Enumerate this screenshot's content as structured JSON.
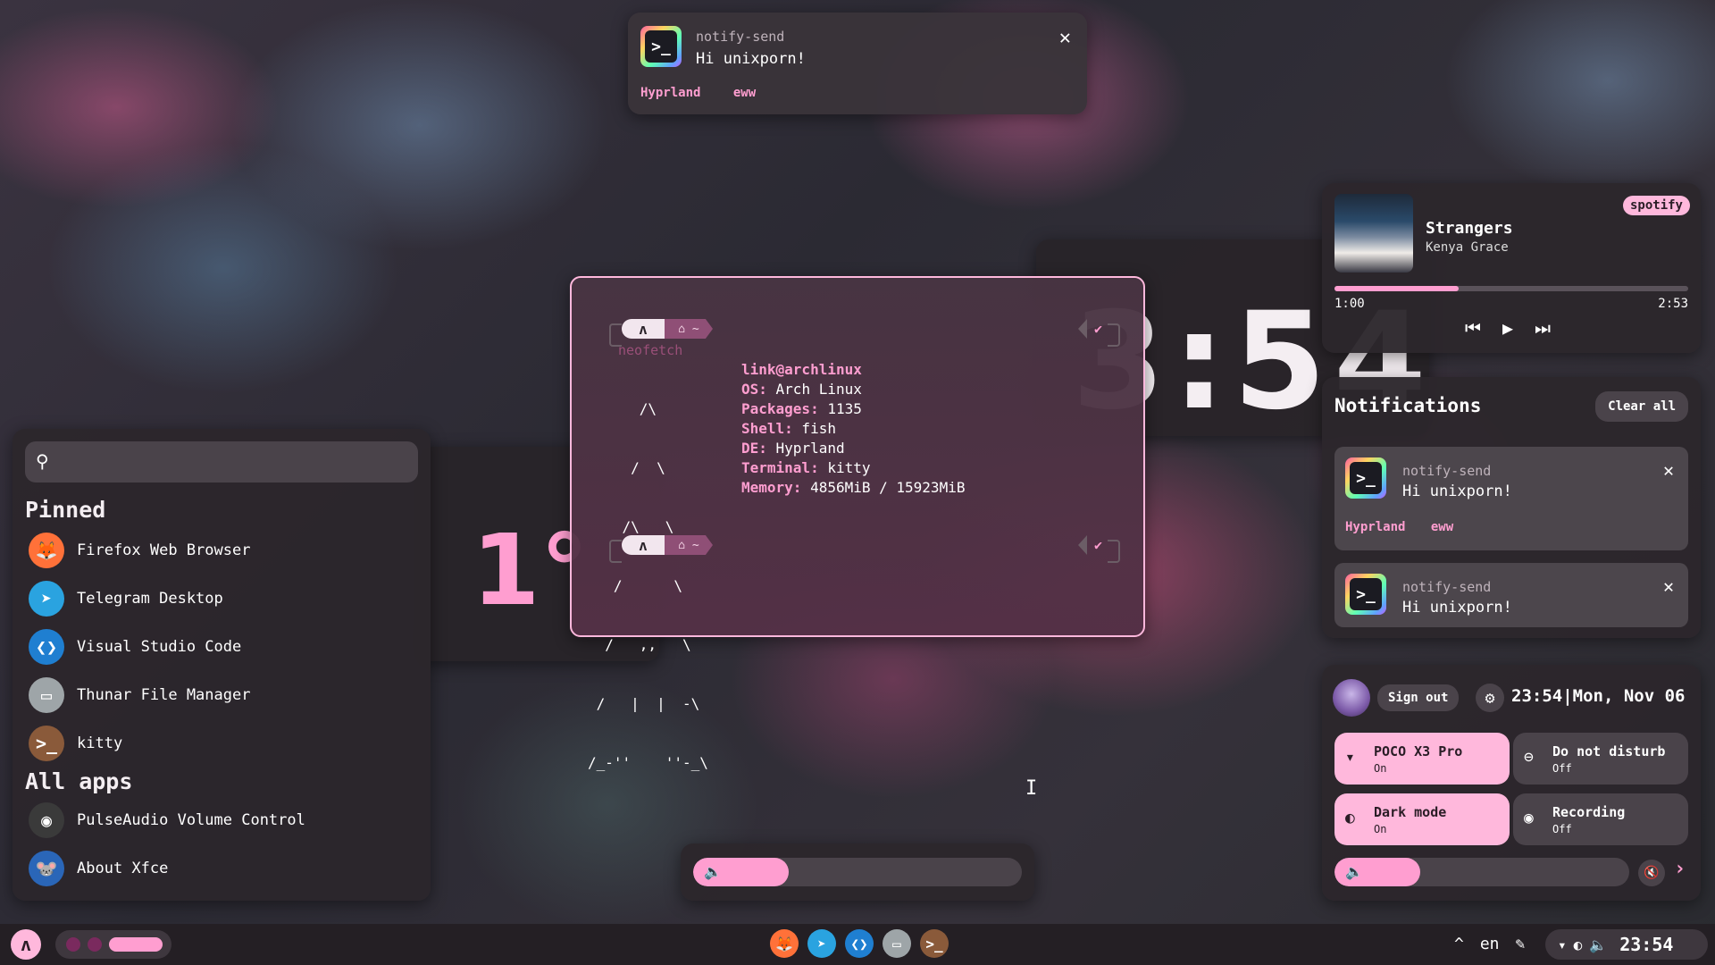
{
  "popup": {
    "app": "notify-send",
    "body": "Hi unixporn!",
    "close": "✕",
    "tags": [
      "Hyprland",
      "eww"
    ]
  },
  "clock": {
    "text": "3:54"
  },
  "weather": {
    "temp": "1°"
  },
  "terminal": {
    "prompt_home": "⌂ ~",
    "prompt_arch": "ʌ",
    "check": "✔",
    "command": "neofetch",
    "ascii": [
      "      /\\",
      "     /  \\",
      "    /\\   \\",
      "   /      \\",
      "  /   ,,   \\",
      " /   |  |  -\\",
      "/_-''    ''-_\\"
    ],
    "info": [
      {
        "key": "link@archlinux",
        "val": ""
      },
      {
        "key": "OS:",
        "val": " Arch Linux"
      },
      {
        "key": "Packages:",
        "val": " 1135"
      },
      {
        "key": "Shell:",
        "val": " fish"
      },
      {
        "key": "DE:",
        "val": " Hyprland"
      },
      {
        "key": "Terminal:",
        "val": " kitty"
      },
      {
        "key": "Memory:",
        "val": " 4856MiB / 15923MiB"
      }
    ]
  },
  "launcher": {
    "search_placeholder": "",
    "pinned_title": "Pinned",
    "all_title": "All apps",
    "pinned": [
      {
        "label": "Firefox Web Browser",
        "icon": "firefox-icon",
        "color": "#ff7139",
        "glyph": "🦊"
      },
      {
        "label": "Telegram Desktop",
        "icon": "telegram-icon",
        "color": "#2aa3e0",
        "glyph": "➤"
      },
      {
        "label": "Visual Studio Code",
        "icon": "vscode-icon",
        "color": "#1f7fd1",
        "glyph": "❮❯"
      },
      {
        "label": "Thunar File Manager",
        "icon": "thunar-icon",
        "color": "#9ea5a8",
        "glyph": "▭"
      },
      {
        "label": "kitty",
        "icon": "kitty-icon",
        "color": "#8a5a3a",
        "glyph": ">_"
      }
    ],
    "all": [
      {
        "label": "PulseAudio Volume Control",
        "icon": "pulseaudio-icon",
        "color": "#3a3a3a",
        "glyph": "◉"
      },
      {
        "label": "About Xfce",
        "icon": "xfce-icon",
        "color": "#2a66b8",
        "glyph": "🐭"
      }
    ]
  },
  "media": {
    "badge": "spotify",
    "title": "Strangers",
    "artist": "Kenya Grace",
    "current": "1:00",
    "total": "2:53",
    "progress": 0.35,
    "prev": "⏮",
    "play": "▶",
    "next": "⏭"
  },
  "notifications": {
    "title": "Notifications",
    "clear": "Clear all",
    "items": [
      {
        "app": "notify-send",
        "body": "Hi unixporn!",
        "tags": [
          "Hyprland",
          "eww"
        ]
      },
      {
        "app": "notify-send",
        "body": "Hi unixporn!",
        "tags": []
      }
    ]
  },
  "quick": {
    "signout": "Sign out",
    "gear": "⚙",
    "time": "23:54|Mon, Nov 06",
    "tiles": [
      {
        "label": "POCO X3 Pro",
        "state": "On",
        "on": true,
        "icon": "▾"
      },
      {
        "label": "Do not disturb",
        "state": "Off",
        "on": false,
        "icon": "⊖"
      },
      {
        "label": "Dark mode",
        "state": "On",
        "on": true,
        "icon": "◐"
      },
      {
        "label": "Recording",
        "state": "Off",
        "on": false,
        "icon": "◉"
      }
    ],
    "volume": 0.29,
    "mute": "🔇",
    "next": "›"
  },
  "osd": {
    "volume": 0.29,
    "speaker": "🔈"
  },
  "bar": {
    "arch": "ʌ",
    "dock": [
      {
        "icon": "firefox-icon",
        "color": "#ff7139",
        "glyph": "🦊"
      },
      {
        "icon": "telegram-icon",
        "color": "#2aa3e0",
        "glyph": "➤"
      },
      {
        "icon": "vscode-icon",
        "color": "#1f7fd1",
        "glyph": "❮❯"
      },
      {
        "icon": "thunar-icon",
        "color": "#9ea5a8",
        "glyph": "▭"
      },
      {
        "icon": "kitty-icon",
        "color": "#8a5a3a",
        "glyph": ">_"
      }
    ],
    "tray_chevron": "^",
    "lang": "en",
    "pen": "✎",
    "wifi": "▾",
    "contrast": "◐",
    "vol": "🔈",
    "time": "23:54"
  }
}
